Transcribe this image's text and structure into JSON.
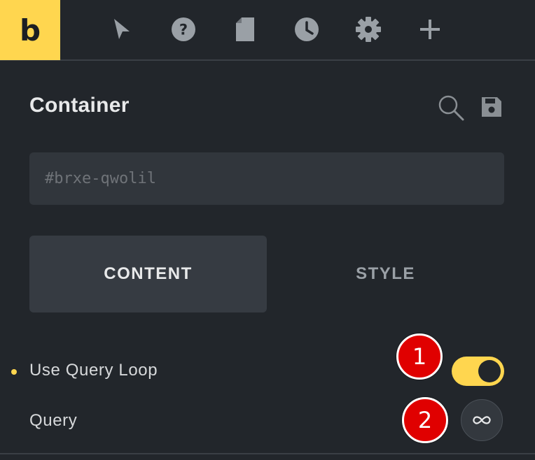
{
  "topbar": {
    "logo": "b",
    "icons": [
      "cursor-arrow-icon",
      "help-icon",
      "page-icon",
      "history-clock-icon",
      "settings-gear-icon",
      "plus-icon"
    ]
  },
  "panel": {
    "title": "Container",
    "header_icons": [
      "search-icon",
      "save-icon"
    ],
    "id_field": {
      "value": "",
      "placeholder": "#brxe-qwolil"
    },
    "tabs": [
      {
        "label": "CONTENT",
        "active": true
      },
      {
        "label": "STYLE",
        "active": false
      }
    ],
    "controls": {
      "use_query_loop": {
        "label": "Use Query Loop",
        "enabled": true
      },
      "query": {
        "label": "Query",
        "icon": "infinity-icon"
      }
    }
  },
  "annotations": [
    "1",
    "2"
  ],
  "colors": {
    "accent": "#ffd64f",
    "background": "#22262b",
    "field_bg": "#31363c",
    "annotation_red": "#e00000"
  }
}
